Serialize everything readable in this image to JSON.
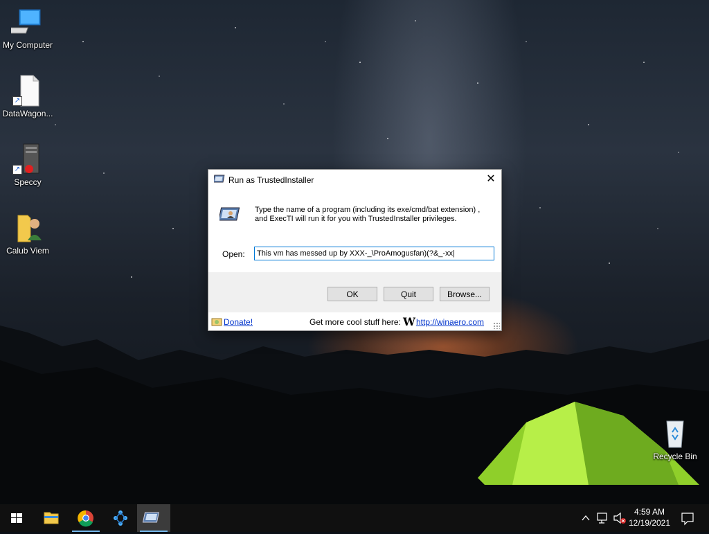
{
  "desktop": {
    "icons": [
      {
        "label": "My Computer",
        "icon": "computer-icon"
      },
      {
        "label": "DataWagon...",
        "icon": "file-shortcut-icon"
      },
      {
        "label": "Speccy",
        "icon": "speccy-icon"
      },
      {
        "label": "Calub Viem",
        "icon": "user-folder-icon"
      },
      {
        "label": "Recycle Bin",
        "icon": "recycle-bin-icon"
      }
    ]
  },
  "dialog": {
    "title": "Run as TrustedInstaller",
    "close_glyph": "✕",
    "description": "Type the name of a program (including its exe/cmd/bat extension) , and ExecTI will run it for you with TrustedInstaller privileges.",
    "open_label": "Open:",
    "open_value": "This vm has messed up by XXX-_\\ProAmogusfan)(?&_-xx|",
    "buttons": {
      "ok": "OK",
      "quit": "Quit",
      "browse": "Browse..."
    },
    "footer": {
      "donate": "Donate!",
      "promo": "Get more cool stuff here:",
      "logo": "W",
      "site": "http://winaero.com"
    }
  },
  "taskbar": {
    "items": [
      "start-icon",
      "file-explorer-icon",
      "chrome-icon",
      "network-app-icon",
      "execti-icon"
    ],
    "time": "4:59 AM",
    "date": "12/19/2021"
  },
  "colors": {
    "accent": "#0078d7",
    "link": "#0033cc",
    "taskbar": "#101010"
  }
}
